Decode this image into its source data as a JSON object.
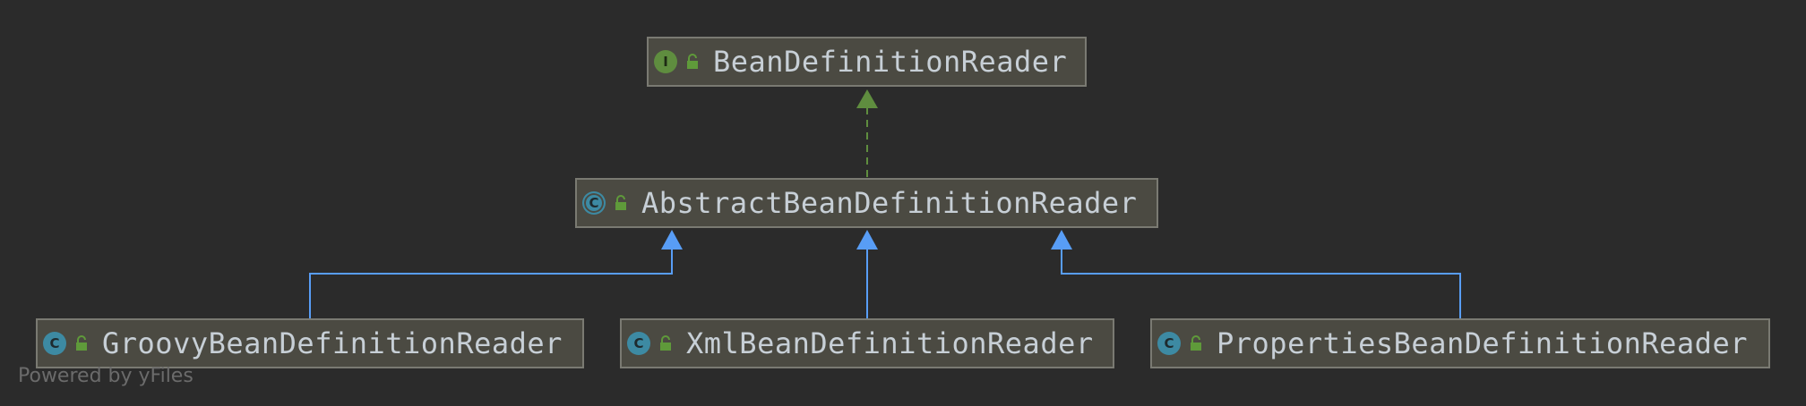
{
  "diagram": {
    "nodes": [
      {
        "id": "bean-definition-reader",
        "kind": "interface",
        "badge": "I",
        "label": "BeanDefinitionReader"
      },
      {
        "id": "abstract-bean-definition-reader",
        "kind": "abstract-class",
        "badge": "C",
        "label": "AbstractBeanDefinitionReader"
      },
      {
        "id": "groovy-bean-definition-reader",
        "kind": "class",
        "badge": "C",
        "label": "GroovyBeanDefinitionReader"
      },
      {
        "id": "xml-bean-definition-reader",
        "kind": "class",
        "badge": "C",
        "label": "XmlBeanDefinitionReader"
      },
      {
        "id": "properties-bean-definition-reader",
        "kind": "class",
        "badge": "C",
        "label": "PropertiesBeanDefinitionReader"
      }
    ],
    "edges": [
      {
        "from": "abstract-bean-definition-reader",
        "to": "bean-definition-reader",
        "type": "implements"
      },
      {
        "from": "groovy-bean-definition-reader",
        "to": "abstract-bean-definition-reader",
        "type": "extends"
      },
      {
        "from": "xml-bean-definition-reader",
        "to": "abstract-bean-definition-reader",
        "type": "extends"
      },
      {
        "from": "properties-bean-definition-reader",
        "to": "abstract-bean-definition-reader",
        "type": "extends"
      }
    ]
  },
  "footer": {
    "text": "Powered by yFiles"
  },
  "colors": {
    "background": "#2b2b2b",
    "node_fill": "#4b4a42",
    "node_border": "#7a7a72",
    "label_text": "#c7cfd6",
    "implements_edge": "#5f8d3f",
    "extends_edge": "#589df6",
    "class_badge": "#3d8aa3",
    "interface_badge": "#5f8d3f",
    "lock_icon": "#5f9a3a"
  }
}
